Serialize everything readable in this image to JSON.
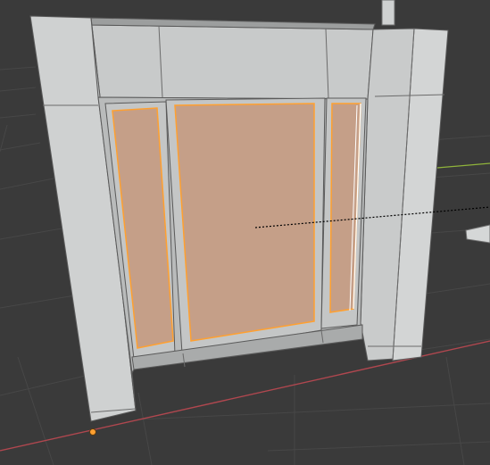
{
  "app": {
    "name": "3D Viewport"
  },
  "viewport": {
    "background": "#3a3a3a",
    "grid_color": "#474747",
    "floor_axis_color": "#b0474f",
    "y_axis_color": "#8fb33b",
    "selection_color": "#ffa030",
    "face_selected_color": "#c59f88",
    "mesh_color": "#d0d2d2"
  },
  "scene": {
    "object": "doorway-mesh",
    "selected_faces": [
      "left-sidelight-glass",
      "center-door-panel",
      "right-sidelight-glass"
    ],
    "has_origin_point": true,
    "has_guide_line": true
  }
}
